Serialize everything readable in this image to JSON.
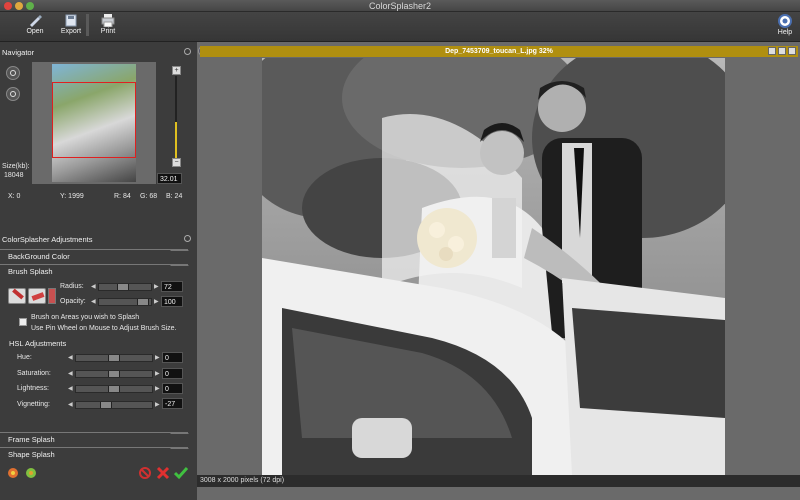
{
  "window": {
    "title": "ColorSplasher2"
  },
  "toolbar": {
    "open": "Open",
    "export": "Export",
    "print": "Print",
    "help": "Help"
  },
  "navigator": {
    "title": "Navigator",
    "zoom_value": "32.01",
    "size_label": "Size(kb):",
    "size_value": "18048",
    "x": "X: 0",
    "y": "Y: 1999",
    "r": "R: 84",
    "g": "G: 68",
    "b": "B: 24"
  },
  "adjustments": {
    "title": "ColorSplasher Adjustments",
    "background_color": "BackGround Color",
    "brush_splash": "Brush Splash",
    "radius_label": "Radius:",
    "radius_value": "72",
    "opacity_label": "Opacity:",
    "opacity_value": "100",
    "hint1": "Brush on Areas you wish to Splash",
    "hint2": "Use Pin Wheel on Mouse to Adjust Brush Size.",
    "hsl_title": "HSL Adjustments",
    "hue_label": "Hue:",
    "hue_value": "0",
    "saturation_label": "Saturation:",
    "saturation_value": "0",
    "lightness_label": "Lightness:",
    "lightness_value": "0",
    "vignetting_label": "Vignetting:",
    "vignetting_value": "-27",
    "frame_splash": "Frame Splash",
    "shape_splash": "Shape Splash"
  },
  "document": {
    "title": "Dep_7453709_toucan_L.jpg 32%",
    "status": "3008 x 2000 pixels (72 dpi)"
  }
}
